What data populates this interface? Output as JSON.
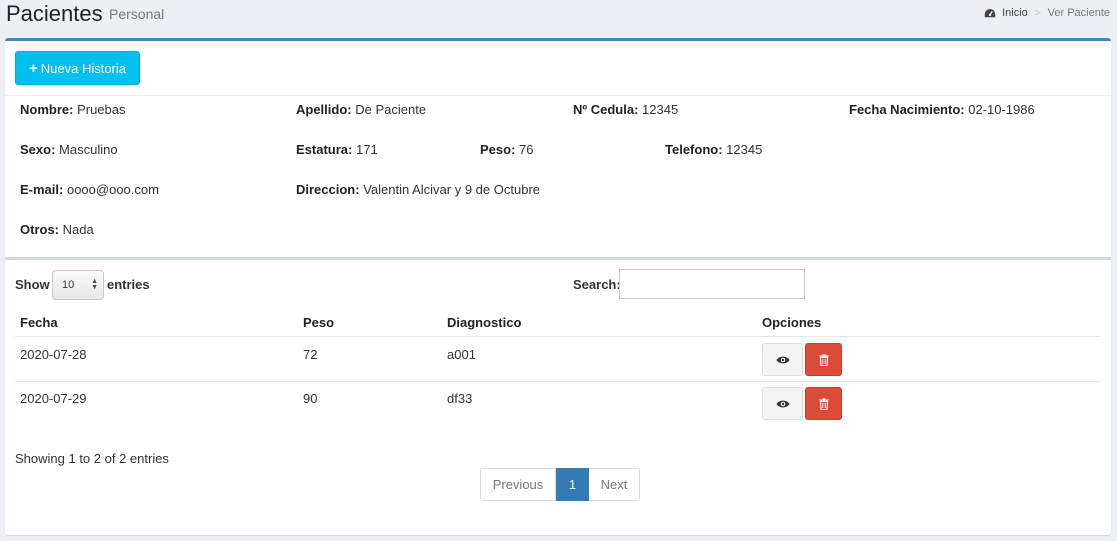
{
  "header": {
    "title": "Pacientes",
    "subtitle": "Personal",
    "breadcrumb": {
      "home": "Inicio",
      "separator": ">",
      "current": "Ver Paciente",
      "home_icon": "dashboard-icon"
    }
  },
  "toolbar": {
    "new_button_icon": "+",
    "new_button": "Nueva Historia"
  },
  "patient": {
    "nombre": {
      "label": "Nombre:",
      "value": "Pruebas"
    },
    "apellido": {
      "label": "Apellido:",
      "value": "De Paciente"
    },
    "cedula": {
      "label": "Nº Cedula:",
      "value": "12345"
    },
    "fecha_nacimiento": {
      "label": "Fecha Nacimiento:",
      "value": "02-10-1986"
    },
    "sexo": {
      "label": "Sexo:",
      "value": "Masculino"
    },
    "estatura": {
      "label": "Estatura:",
      "value": "171"
    },
    "peso": {
      "label": "Peso:",
      "value": "76"
    },
    "telefono": {
      "label": "Telefono:",
      "value": "12345"
    },
    "email": {
      "label": "E-mail:",
      "value": "oooo@ooo.com"
    },
    "direccion": {
      "label": "Direccion:",
      "value": "Valentin Alcivar y 9 de Octubre"
    },
    "otros": {
      "label": "Otros:",
      "value": "Nada"
    }
  },
  "table_controls": {
    "show_label": "Show",
    "page_size": "10",
    "entries_label": "entries",
    "search_label": "Search:",
    "search_value": ""
  },
  "table": {
    "headers": [
      "Fecha",
      "Peso",
      "Diagnostico",
      "Opciones"
    ],
    "rows": [
      {
        "fecha": "2020-07-28",
        "peso": "72",
        "diagnostico": "a001"
      },
      {
        "fecha": "2020-07-29",
        "peso": "90",
        "diagnostico": "df33"
      }
    ],
    "row_action_icons": [
      "eye-icon",
      "trash-icon"
    ]
  },
  "footer": {
    "showing": "Showing 1 to 2 of 2 entries",
    "previous": "Previous",
    "current_page": "1",
    "next": "Next"
  },
  "colors": {
    "info_button": "#00c0ef",
    "danger_button": "#dd4b39",
    "page_active": "#337ab7",
    "box_top_border": "#3c8dbc"
  }
}
